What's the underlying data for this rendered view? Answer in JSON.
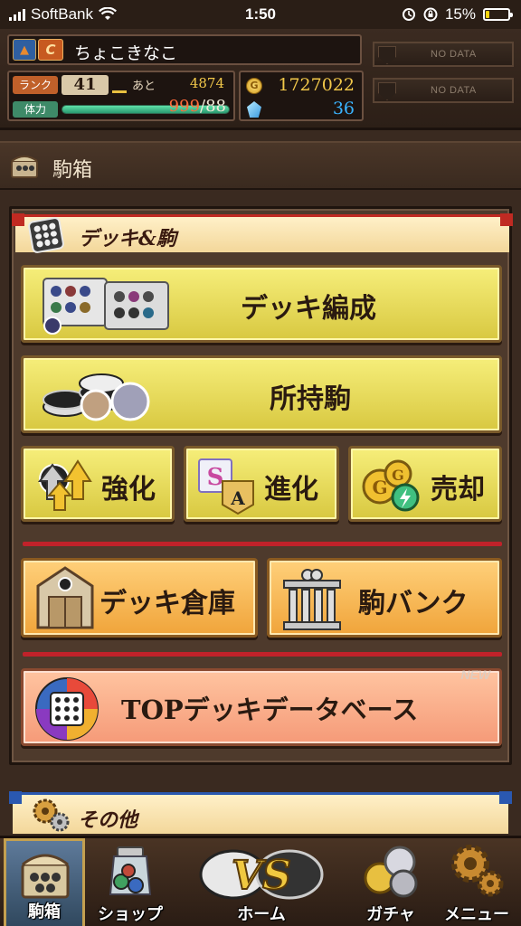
{
  "status_bar": {
    "carrier": "SoftBank",
    "time": "1:50",
    "battery_percent": "15%",
    "battery_level": 0.15
  },
  "player": {
    "name": "ちょこきなこ",
    "class_letter": "C",
    "rank_label": "ランク",
    "rank": "41",
    "exp_label": "あと",
    "exp_remaining": "4874",
    "stamina_label": "体力",
    "stamina_current": "999",
    "stamina_max": "/88",
    "coins": "1727022",
    "gems": "36"
  },
  "slots": [
    "NO DATA",
    "NO DATA"
  ],
  "section": {
    "title": "駒箱"
  },
  "deck_group": {
    "title": "デッキ&駒",
    "buttons": {
      "deck_edit": "デッキ編成",
      "owned_pieces": "所持駒",
      "power_up": "強化",
      "evolve": "進化",
      "sell": "売却",
      "deck_storage": "デッキ倉庫",
      "piece_bank": "駒バンク",
      "top_deck_db": "TOPデッキデータベース"
    },
    "new_tag": "NEW"
  },
  "other_group": {
    "title": "その他"
  },
  "bottom_nav": {
    "items": [
      {
        "label": "駒箱",
        "icon": "chest-icon"
      },
      {
        "label": "ショップ",
        "icon": "shop-icon"
      },
      {
        "label": "ホーム",
        "icon": "vs-icon"
      },
      {
        "label": "ガチャ",
        "icon": "coins-icon"
      },
      {
        "label": "メニュー",
        "icon": "gear-icon"
      }
    ]
  },
  "colors": {
    "accent_red": "#c0222a",
    "accent_blue": "#2a58b0",
    "button_yellow": "#e8dc5a",
    "button_orange": "#f5b850",
    "button_salmon": "#f8ac88"
  }
}
